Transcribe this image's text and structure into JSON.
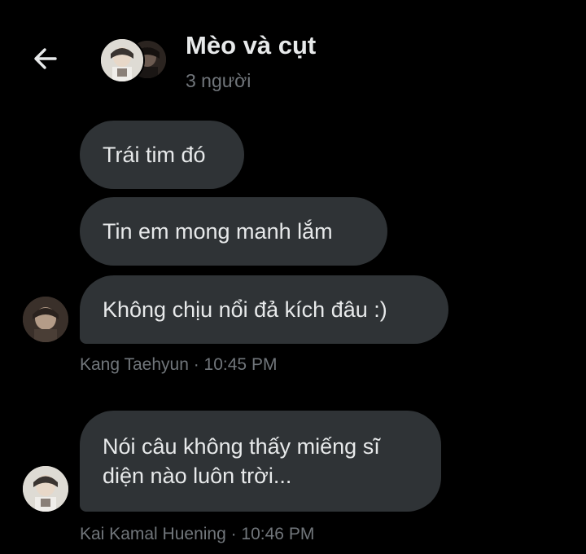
{
  "header": {
    "title": "Mèo và cụt",
    "subtitle": "3 người",
    "back_icon": "arrow-left-icon"
  },
  "messages": [
    {
      "text": "Trái tim đó"
    },
    {
      "text": "Tin em mong manh lắm"
    },
    {
      "text": "Không chịu nổi đả kích đâu :)"
    },
    {
      "sender": "Kang Taehyun",
      "time": "10:45 PM"
    },
    {
      "text": "Nói câu không thấy miếng sĩ\ndiện nào luôn trời..."
    },
    {
      "sender": "Kai Kamal Huening",
      "time": "10:46 PM"
    }
  ],
  "meta": {
    "group1": "Kang Taehyun · 10:45 PM",
    "group2": "Kai Kamal Huening · 10:46 PM"
  },
  "colors": {
    "background": "#000000",
    "bubble": "#2f3336",
    "text": "#e7e9ea",
    "muted": "#71767b"
  }
}
